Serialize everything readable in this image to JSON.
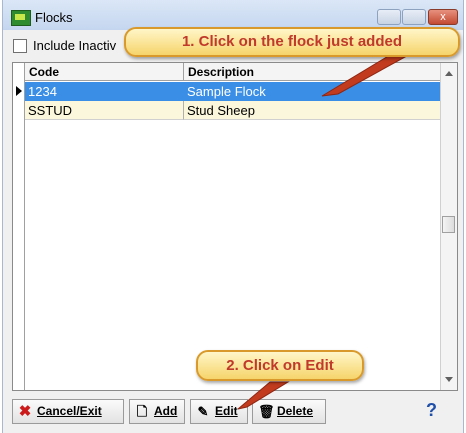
{
  "window": {
    "title": "Flocks",
    "icons": {
      "app": "flock-app-icon",
      "minimize": "minimize-icon",
      "maximize": "maximize-icon",
      "close": "close-icon"
    },
    "close_glyph": "x"
  },
  "filter": {
    "include_inactive_label": "Include Inactiv",
    "checked": false
  },
  "grid": {
    "columns": [
      "Code",
      "Description"
    ],
    "rows": [
      {
        "code": "1234",
        "description": "Sample Flock",
        "selected": true
      },
      {
        "code": "SSTUD",
        "description": "Stud Sheep",
        "selected": false
      }
    ]
  },
  "buttons": {
    "cancel_exit": "Cancel/Exit",
    "add": "Add",
    "edit": "Edit",
    "delete": "Delete",
    "help": "?"
  },
  "callouts": {
    "step1": "1. Click on the flock just added",
    "step2": "2. Click on Edit"
  },
  "colors": {
    "selection": "#3a8ee6",
    "alt_row": "#fbf7dc",
    "callout_text": "#c0392b",
    "callout_fill": "#f6d46b"
  }
}
